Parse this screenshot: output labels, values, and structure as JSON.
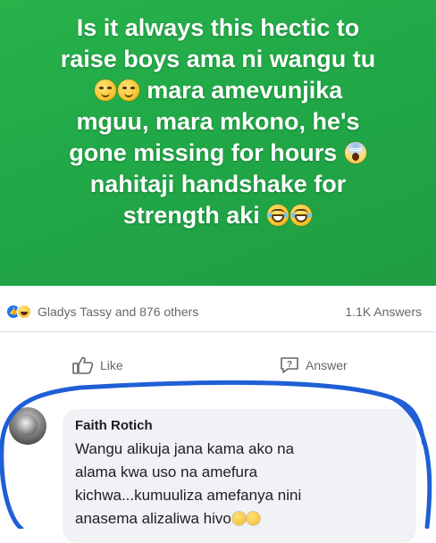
{
  "post": {
    "text_lines": [
      "Is it always this hectic to",
      "raise boys ama ni wangu tu",
      "mara amevunjika",
      "mguu, mara mkono, he's",
      "gone missing for hours",
      "nahitaji handshake for",
      "strength aki"
    ],
    "emojis": [
      "smirking-face",
      "smirking-face",
      "face-screaming-in-fear",
      "face-with-tears-of-joy",
      "face-with-tears-of-joy"
    ],
    "background_color": "#21a847",
    "text_color": "#ffffff"
  },
  "stats": {
    "reactions_label": "Gladys Tassy and 876 others",
    "answers_label": "1.1K Answers",
    "reaction_icons": [
      "like-reaction-icon",
      "haha-reaction-icon"
    ]
  },
  "actions": {
    "like_label": "Like",
    "answer_label": "Answer"
  },
  "comment": {
    "author": "Faith Rotich",
    "lines": [
      "Wangu alikuja jana kama ako na",
      "alama kwa uso na amefura",
      "kichwa...kumuuliza amefanya nini",
      "anasema alizaliwa hivo"
    ],
    "trailing_emojis": [
      "smirking-face",
      "smirking-face"
    ],
    "highlight_color": "#1f5fd6"
  }
}
